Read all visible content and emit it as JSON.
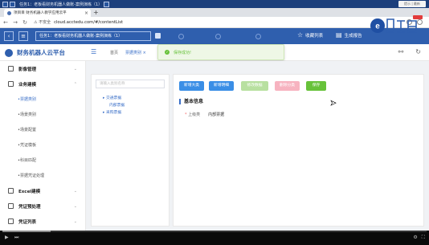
{
  "player": {
    "title_bar_text": "任务1：老板看财务机器人做账-案例演练（1）",
    "corner_tag": "提示 | 最新"
  },
  "browser": {
    "tab_title": "项目目 财务机器人教学应用云平",
    "tab_close": "×",
    "new_tab": "+",
    "security_label": "不安全",
    "url": "cloud.acctedu.com/#/contentList"
  },
  "app_top": {
    "tab_label": "任务1：老板看财务机器人做账-案例演练（1）",
    "links": [
      {
        "label": "收藏列表",
        "icon": "star-icon"
      },
      {
        "label": "生成报告",
        "icon": "report-icon"
      }
    ]
  },
  "toast": {
    "text": "保存成功!"
  },
  "header": {
    "brand": "财务机器人云平台",
    "breadcrumbs": [
      "首页",
      "票据类别"
    ],
    "close_tag": "×"
  },
  "sidebar": {
    "items": [
      {
        "label": "影像管理"
      },
      {
        "label": "业务建模"
      }
    ],
    "subitems": [
      "票据类别",
      "场景类别",
      "场景配置",
      "凭证模板",
      "科目匹配",
      "票据凭证处理"
    ],
    "bottom_items": [
      {
        "label": "Excel建模"
      },
      {
        "label": "凭证预处理"
      },
      {
        "label": "凭证列表"
      }
    ]
  },
  "tree": {
    "placeholder": "请输入类别名称",
    "nodes": [
      "交通票据",
      "内部票据",
      "采购票据"
    ]
  },
  "toolbar": {
    "buttons": [
      "新增大类",
      "新增明细",
      "修改数据",
      "删除分类",
      "保存"
    ]
  },
  "form": {
    "section_title": "基本信息",
    "required_mark": "*",
    "field_label": "上级类",
    "field_value": "内部票据"
  },
  "colors": {
    "brand_blue": "#2f5fae",
    "primary": "#3a8ee6",
    "success": "#67c23a"
  }
}
